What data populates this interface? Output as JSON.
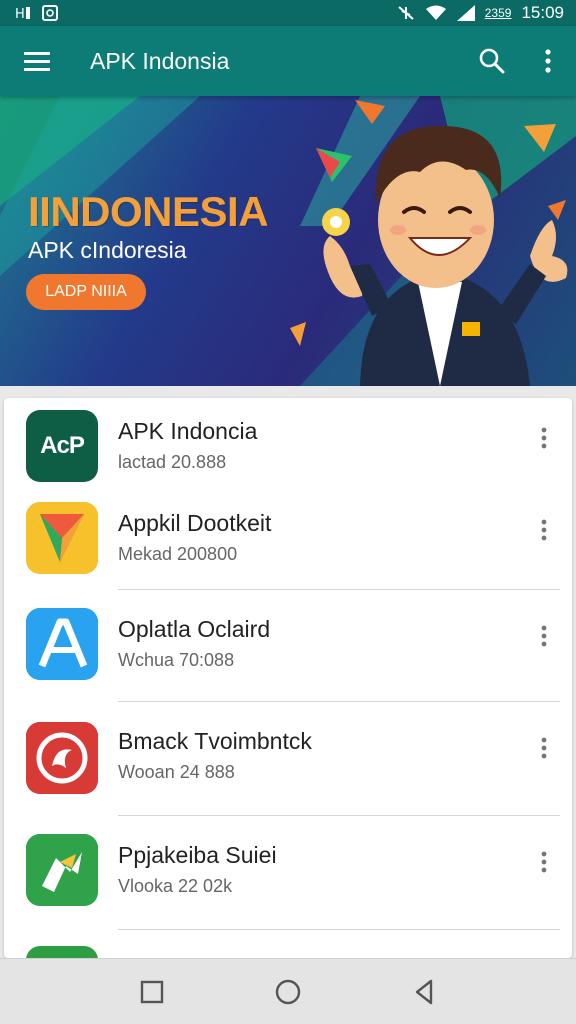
{
  "status_bar": {
    "left_icons": [
      "sim-icon",
      "notification-icon"
    ],
    "battery_text": "2359",
    "time": "15:09"
  },
  "app_bar": {
    "title": "APK Indonsia",
    "actions": [
      "search-icon",
      "overflow-menu-icon"
    ]
  },
  "banner": {
    "headline": "IINDONESIA",
    "subtitle": "APK cIndoresia",
    "cta_label": "LADP NIIIA"
  },
  "apps": [
    {
      "name": "APK Indoncia",
      "meta": "lactad 20.888",
      "icon_text": "AcP",
      "icon_color": "#0d5e44"
    },
    {
      "name": "Appkil Dootkeit",
      "meta": "Mekad 200800",
      "icon_color": "#f4b400"
    },
    {
      "name": "Oplatla Oclaird",
      "meta": "Wchua 70:088",
      "icon_color": "#2196f3"
    },
    {
      "name": "Bmack Tvoimbntck",
      "meta": "Wooan 24 888",
      "icon_color": "#d32f2f"
    },
    {
      "name": "Ppjakeiba Suiei",
      "meta": "Vlooka 22 02k",
      "icon_color": "#2e9e44"
    }
  ],
  "nav_bar": [
    "recents-icon",
    "home-icon",
    "back-icon"
  ],
  "colors": {
    "primary": "#0e7c76",
    "status": "#0b6a64",
    "accent": "#f0782e"
  }
}
